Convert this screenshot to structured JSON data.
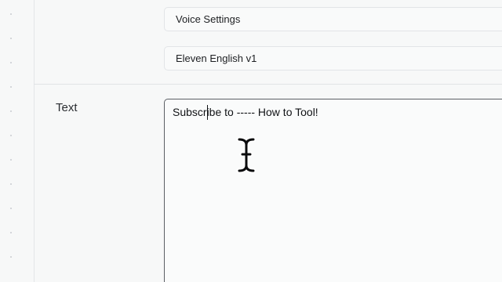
{
  "voice_settings": {
    "label": "Voice Settings"
  },
  "model": {
    "selected": "Eleven English v1"
  },
  "text_section": {
    "label": "Text",
    "value": "Subscribe to ----- How to Tool!"
  },
  "cursor": {
    "icon": "i-beam-cursor-icon"
  }
}
